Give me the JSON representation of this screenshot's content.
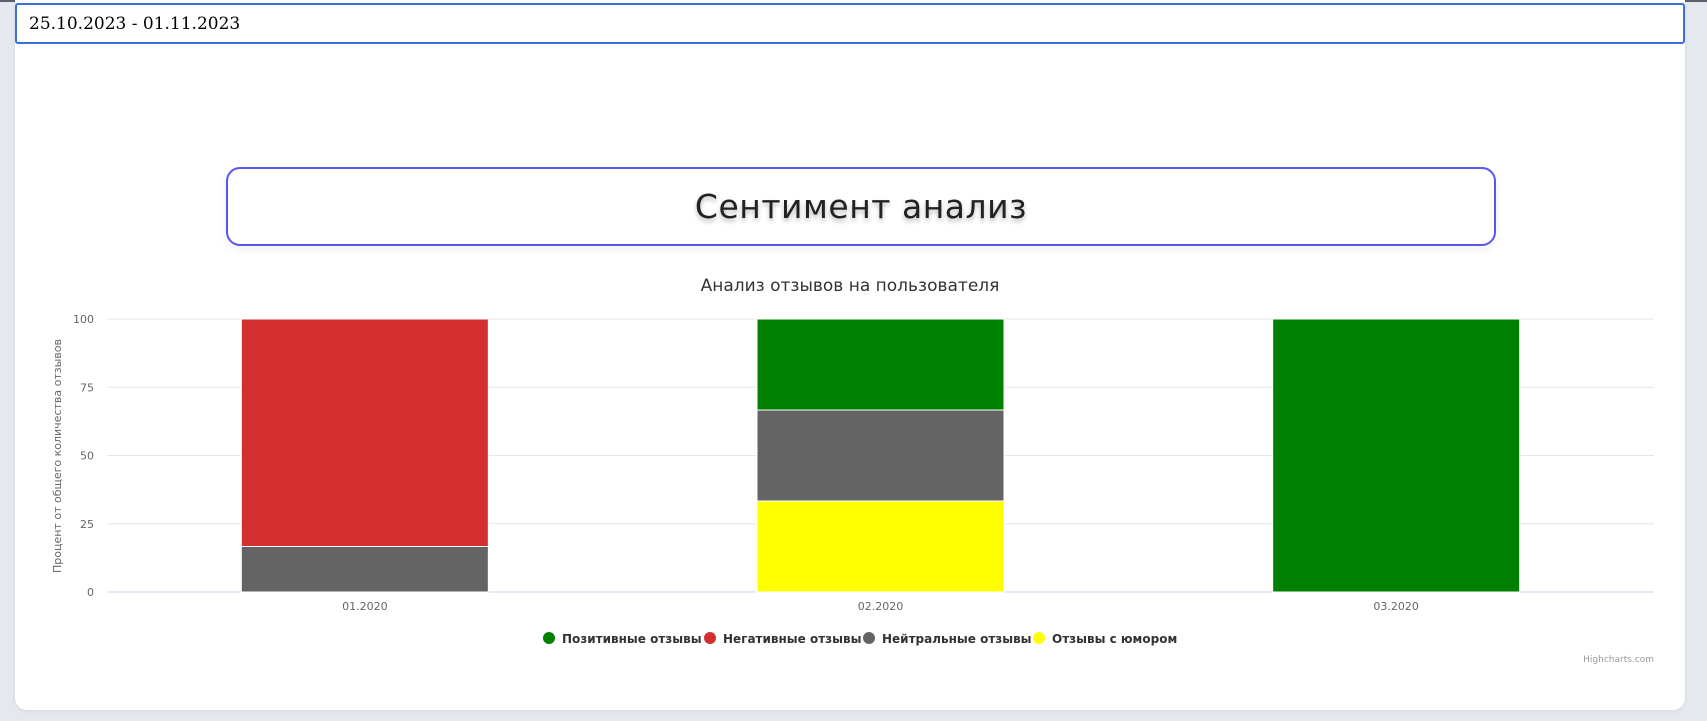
{
  "date_range": "25.10.2023 - 01.11.2023",
  "page_title": "Сентимент анализ",
  "chart_data": {
    "type": "bar",
    "stacked": true,
    "title": "Анализ отзывов на пользователя",
    "xlabel": "",
    "ylabel": "Процент от общего количества отзывов",
    "categories": [
      "01.2020",
      "02.2020",
      "03.2020"
    ],
    "ylim": [
      0,
      100
    ],
    "yticks": [
      0,
      25,
      50,
      75,
      100
    ],
    "grid": true,
    "legend_position": "bottom-center",
    "series": [
      {
        "name": "Позитивные отзывы",
        "color": "#008000",
        "values": [
          0,
          33.33,
          100
        ]
      },
      {
        "name": "Негативные отзывы",
        "color": "#d32f2f",
        "values": [
          83.33,
          0,
          0
        ]
      },
      {
        "name": "Нейтральные отзывы",
        "color": "#646464",
        "values": [
          16.67,
          33.33,
          0
        ]
      },
      {
        "name": "Отзывы с юмором",
        "color": "#ffff00",
        "values": [
          0,
          33.33,
          0
        ]
      }
    ],
    "credits": "Highcharts.com"
  }
}
